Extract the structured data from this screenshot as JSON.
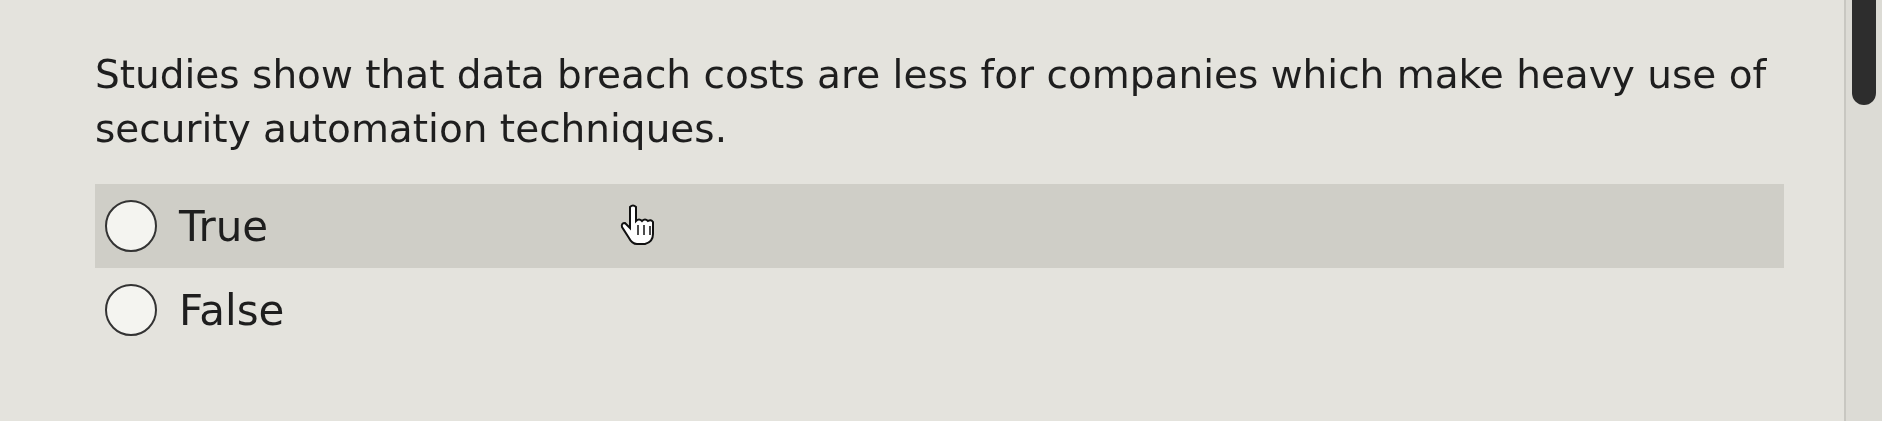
{
  "question": {
    "text": "Studies show that data breach costs are less for companies which make heavy use of security automation techniques."
  },
  "options": [
    {
      "label": "True",
      "selected": false,
      "highlighted": true
    },
    {
      "label": "False",
      "selected": false,
      "highlighted": false
    }
  ]
}
